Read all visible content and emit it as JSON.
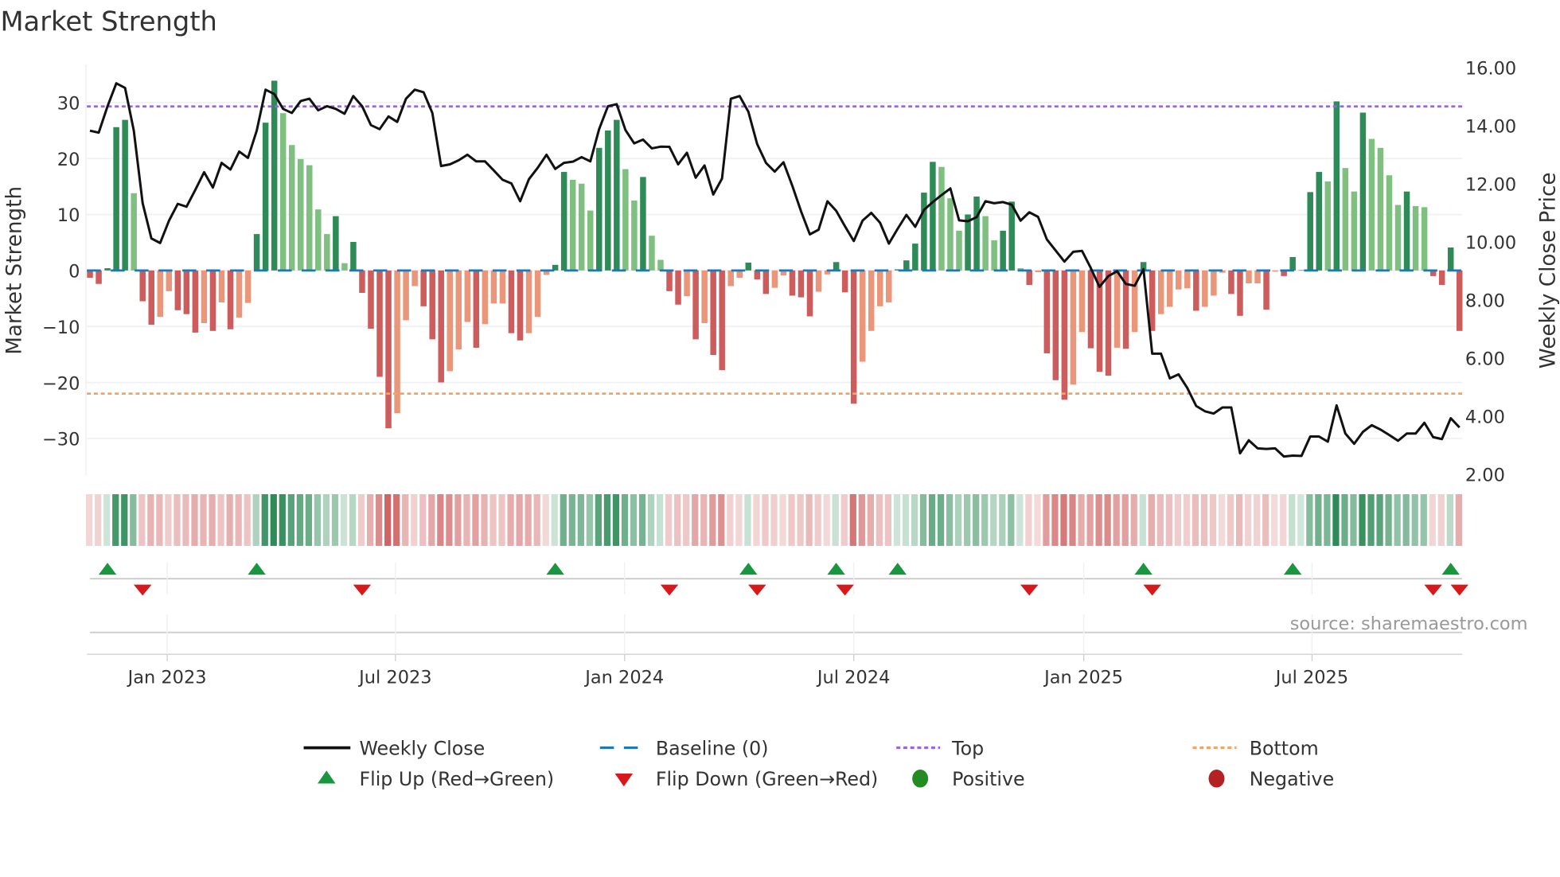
{
  "colors": {
    "pos_strong": "#2e8b57",
    "pos_weak": "#7fbf7f",
    "neg_strong": "#cd5c5c",
    "neg_weak": "#e9967a",
    "baseline": "#1f77b4",
    "top": "#9467dd",
    "bottom": "#f4a460",
    "close": "#111111",
    "flip_up": "#1a9641",
    "flip_down": "#d7191c",
    "positive_dot": "#228b22",
    "negative_dot": "#b22222"
  },
  "chart_data": {
    "type": "bar",
    "title": "Market Strength",
    "ylabel": "Market Strength",
    "y2label": "Weekly Close Price",
    "ylim": [
      -37,
      37
    ],
    "y2lim": [
      2,
      16
    ],
    "yticks": [
      -30,
      -20,
      -10,
      0,
      10,
      20,
      30
    ],
    "y2ticks": [
      "2.00",
      "4.00",
      "6.00",
      "8.00",
      "10.00",
      "12.00",
      "14.00",
      "16.00"
    ],
    "top_level": 29.3,
    "bottom_level": -22.0,
    "baseline_level": 0,
    "x_ticks": [
      {
        "label": "Jan 2023",
        "week": 8.8
      },
      {
        "label": "Jul 2023",
        "week": 34.8
      },
      {
        "label": "Jan 2024",
        "week": 60.9
      },
      {
        "label": "Jul 2024",
        "week": 87.0
      },
      {
        "label": "Jan 2025",
        "week": 113.2
      },
      {
        "label": "Jul 2025",
        "week": 139.2
      }
    ],
    "strength": [
      -1.3,
      -2.4,
      0.4,
      25.6,
      26.9,
      13.8,
      -5.5,
      -9.7,
      -8.3,
      -3.7,
      -7.1,
      -7.8,
      -11.1,
      -9.4,
      -10.8,
      -5.7,
      -10.5,
      -8.4,
      -5.8,
      6.5,
      26.4,
      33.9,
      28.1,
      22.4,
      19.9,
      18.8,
      10.9,
      6.5,
      9.7,
      1.3,
      5.1,
      -4.0,
      -10.4,
      -19.0,
      -28.2,
      -25.5,
      -8.9,
      -2.8,
      -6.4,
      -12.3,
      -20.0,
      -18.0,
      -14.1,
      -9.2,
      -13.8,
      -9.6,
      -5.9,
      -5.9,
      -11.2,
      -12.5,
      -11.2,
      -8.3,
      -0.8,
      1.0,
      17.6,
      16.2,
      15.5,
      10.7,
      21.9,
      25.0,
      26.9,
      18.1,
      12.5,
      16.7,
      6.2,
      1.9,
      -3.7,
      -6.1,
      -4.6,
      -12.3,
      -9.4,
      -15.1,
      -17.8,
      -2.8,
      -1.3,
      1.4,
      -1.6,
      -4.2,
      -3.1,
      -0.9,
      -4.5,
      -4.8,
      -8.2,
      -3.8,
      -0.7,
      1.5,
      -3.9,
      -23.8,
      -16.3,
      -10.8,
      -6.4,
      -5.7,
      0.2,
      1.8,
      4.8,
      13.9,
      19.4,
      18.5,
      12.9,
      7.1,
      10.0,
      13.2,
      9.7,
      5.4,
      7.1,
      12.3,
      0.4,
      -2.6,
      -0.3,
      -14.8,
      -19.6,
      -23.1,
      -20.4,
      -11.0,
      -13.9,
      -18.1,
      -18.8,
      -13.8,
      -14.0,
      -11.0,
      1.5,
      -10.8,
      -7.8,
      -6.5,
      -3.4,
      -3.2,
      -7.2,
      -6.5,
      -4.5,
      -0.4,
      -4.2,
      -8.1,
      -2.3,
      -2.3,
      -7.0,
      -0.2,
      -1.0,
      2.4,
      0.1,
      14.0,
      17.6,
      15.9,
      30.2,
      18.3,
      14.1,
      28.2,
      23.5,
      21.9,
      17.0,
      11.7,
      14.1,
      11.5,
      11.3,
      -1.0,
      -2.6,
      4.1,
      -10.8
    ],
    "close": [
      13.83,
      13.76,
      14.67,
      15.46,
      15.3,
      13.83,
      11.33,
      10.12,
      9.96,
      10.73,
      11.31,
      11.21,
      11.79,
      12.4,
      11.87,
      12.72,
      12.49,
      13.11,
      12.89,
      13.83,
      15.24,
      15.09,
      14.58,
      14.44,
      14.85,
      14.93,
      14.53,
      14.67,
      14.58,
      14.41,
      15.02,
      14.67,
      14.02,
      13.88,
      14.32,
      14.13,
      14.93,
      15.24,
      15.15,
      14.44,
      12.61,
      12.67,
      12.81,
      13.0,
      12.77,
      12.77,
      12.46,
      12.14,
      12.01,
      11.4,
      12.16,
      12.55,
      13.0,
      12.51,
      12.72,
      12.76,
      12.92,
      12.77,
      13.88,
      14.67,
      14.74,
      13.85,
      13.39,
      13.52,
      13.22,
      13.28,
      13.27,
      12.67,
      13.07,
      12.21,
      12.63,
      11.63,
      12.18,
      14.93,
      15.02,
      14.48,
      13.37,
      12.72,
      12.42,
      12.74,
      11.93,
      11.05,
      10.26,
      10.42,
      11.4,
      11.07,
      10.54,
      10.03,
      10.73,
      11.0,
      10.66,
      9.94,
      10.45,
      10.93,
      10.52,
      11.1,
      11.37,
      11.61,
      11.84,
      10.74,
      10.71,
      10.85,
      11.4,
      11.33,
      11.37,
      11.28,
      10.73,
      11.02,
      10.86,
      10.08,
      9.7,
      9.32,
      9.66,
      9.69,
      9.1,
      8.45,
      8.82,
      8.99,
      8.55,
      8.49,
      9.06,
      6.15,
      6.15,
      5.3,
      5.44,
      4.97,
      4.35,
      4.17,
      4.09,
      4.3,
      4.3,
      2.72,
      3.17,
      2.89,
      2.87,
      2.89,
      2.61,
      2.64,
      2.63,
      3.3,
      3.3,
      3.12,
      4.37,
      3.4,
      3.05,
      3.46,
      3.69,
      3.54,
      3.35,
      3.15,
      3.4,
      3.4,
      3.77,
      3.28,
      3.21,
      3.93,
      3.61
    ]
  },
  "header": {
    "title": "Market Strength"
  },
  "axes": {
    "left_title": "Market Strength",
    "right_title": "Weekly Close Price"
  },
  "source": "source: sharemaestro.com",
  "legend": {
    "weekly_close": "Weekly Close",
    "baseline": "Baseline (0)",
    "top": "Top",
    "bottom": "Bottom",
    "flip_up": "Flip Up (Red→Green)",
    "flip_down": "Flip Down (Green→Red)",
    "positive": "Positive",
    "negative": "Negative"
  }
}
